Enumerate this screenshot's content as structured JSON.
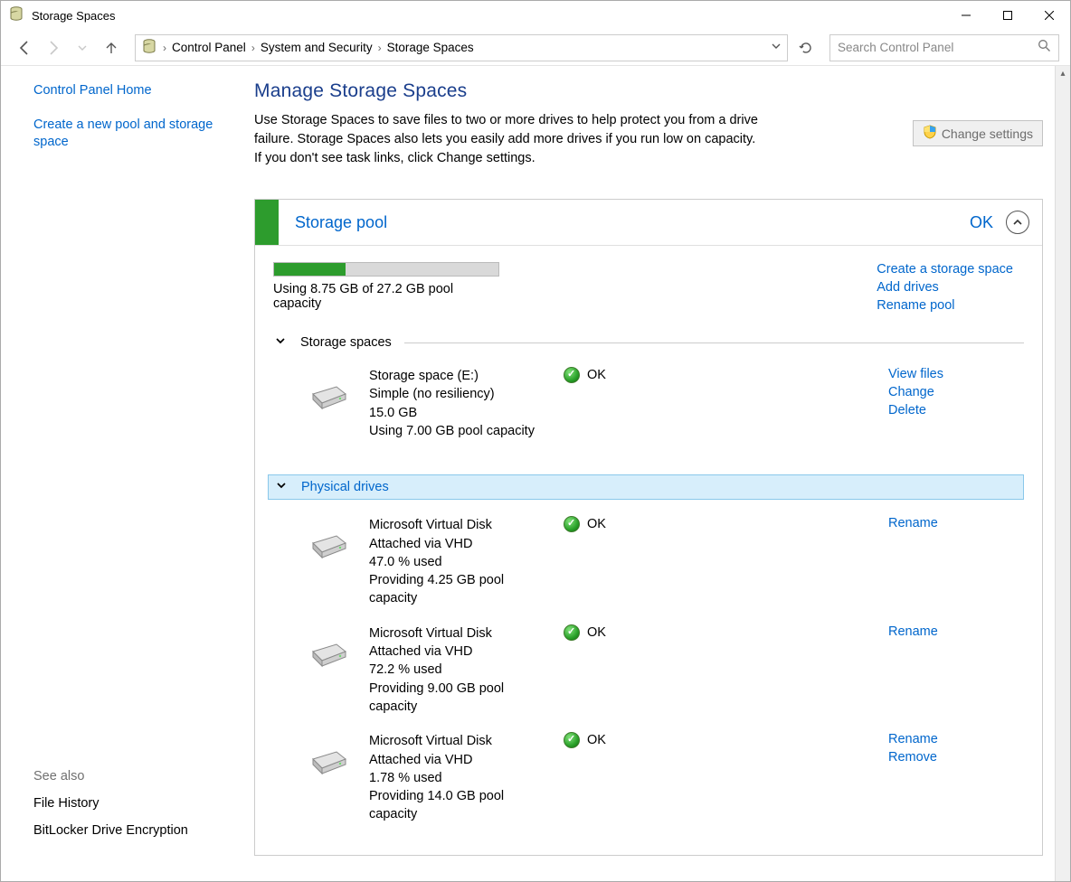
{
  "window": {
    "title": "Storage Spaces"
  },
  "breadcrumb": {
    "items": [
      "Control Panel",
      "System and Security",
      "Storage Spaces"
    ]
  },
  "search": {
    "placeholder": "Search Control Panel"
  },
  "left_pane": {
    "home": "Control Panel Home",
    "create": "Create a new pool and storage space",
    "see_also_title": "See also",
    "refs": [
      "File History",
      "BitLocker Drive Encryption"
    ]
  },
  "main": {
    "title": "Manage Storage Spaces",
    "desc": "Use Storage Spaces to save files to two or more drives to help protect you from a drive failure. Storage Spaces also lets you easily add more drives if you run low on capacity. If you don't see task links, click Change settings.",
    "change_settings": "Change settings"
  },
  "pool": {
    "title": "Storage pool",
    "status": "OK",
    "usage_text": "Using 8.75 GB of 27.2 GB pool capacity",
    "progress_pct": 32,
    "actions": [
      "Create a storage space",
      "Add drives",
      "Rename pool"
    ],
    "spaces_section": "Storage spaces",
    "drives_section": "Physical drives",
    "spaces": [
      {
        "lines": [
          "Storage space (E:)",
          "Simple (no resiliency)",
          "15.0 GB",
          "Using 7.00 GB pool capacity"
        ],
        "status": "OK",
        "actions": [
          "View files",
          "Change",
          "Delete"
        ]
      }
    ],
    "drives": [
      {
        "lines": [
          "Microsoft Virtual Disk",
          "Attached via VHD",
          "47.0 % used",
          "Providing 4.25 GB pool capacity"
        ],
        "status": "OK",
        "actions": [
          "Rename"
        ]
      },
      {
        "lines": [
          "Microsoft Virtual Disk",
          "Attached via VHD",
          "72.2 % used",
          "Providing 9.00 GB pool capacity"
        ],
        "status": "OK",
        "actions": [
          "Rename"
        ]
      },
      {
        "lines": [
          "Microsoft Virtual Disk",
          "Attached via VHD",
          "1.78 % used",
          "Providing 14.0 GB pool capacity"
        ],
        "status": "OK",
        "actions": [
          "Rename",
          "Remove"
        ]
      }
    ]
  }
}
